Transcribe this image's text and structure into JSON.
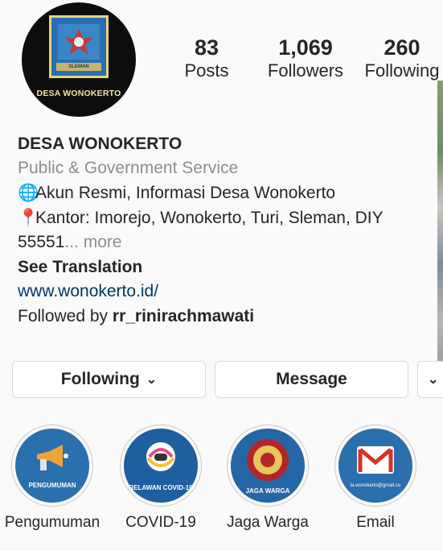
{
  "profile": {
    "avatar_text": "DESA WONOKERTO",
    "avatar_banner": "SLEMAN",
    "stats": [
      {
        "value": "83",
        "label": "Posts"
      },
      {
        "value": "1,069",
        "label": "Followers"
      },
      {
        "value": "260",
        "label": "Following"
      }
    ],
    "display_name": "DESA WONOKERTO",
    "category": "Public & Government Service",
    "bio_line1": "Akun Resmi, Informasi Desa Wonokerto",
    "bio_line2": "Kantor: Imorejo, Wonokerto, Turi, Sleman, DIY",
    "bio_line3": "55551",
    "bio_more": "... more",
    "see_translation": "See Translation",
    "website": "www.wonokerto.id/",
    "followed_by_prefix": "Followed by ",
    "followed_by_user": "rr_rinirachmawati",
    "icons": {
      "globe": "globe-icon",
      "pin": "pushpin-icon"
    }
  },
  "actions": {
    "following_label": "Following",
    "message_label": "Message"
  },
  "highlights": [
    {
      "label": "Pengumuman",
      "tag": "PENGUMUMAN",
      "icon": "megaphone-icon"
    },
    {
      "label": "COVID-19",
      "tag": "RELAWAN COVID-19",
      "icon": "game-controller-icon"
    },
    {
      "label": "Jaga Warga",
      "tag": "JAGA WARGA",
      "icon": "emblem-icon"
    },
    {
      "label": "Email",
      "tag": "la.wonokerto@gmail.co",
      "icon": "gmail-icon"
    }
  ],
  "colors": {
    "link": "#00376b",
    "muted": "#8e8e8e",
    "highlight_bg": "#1f6aa8"
  }
}
